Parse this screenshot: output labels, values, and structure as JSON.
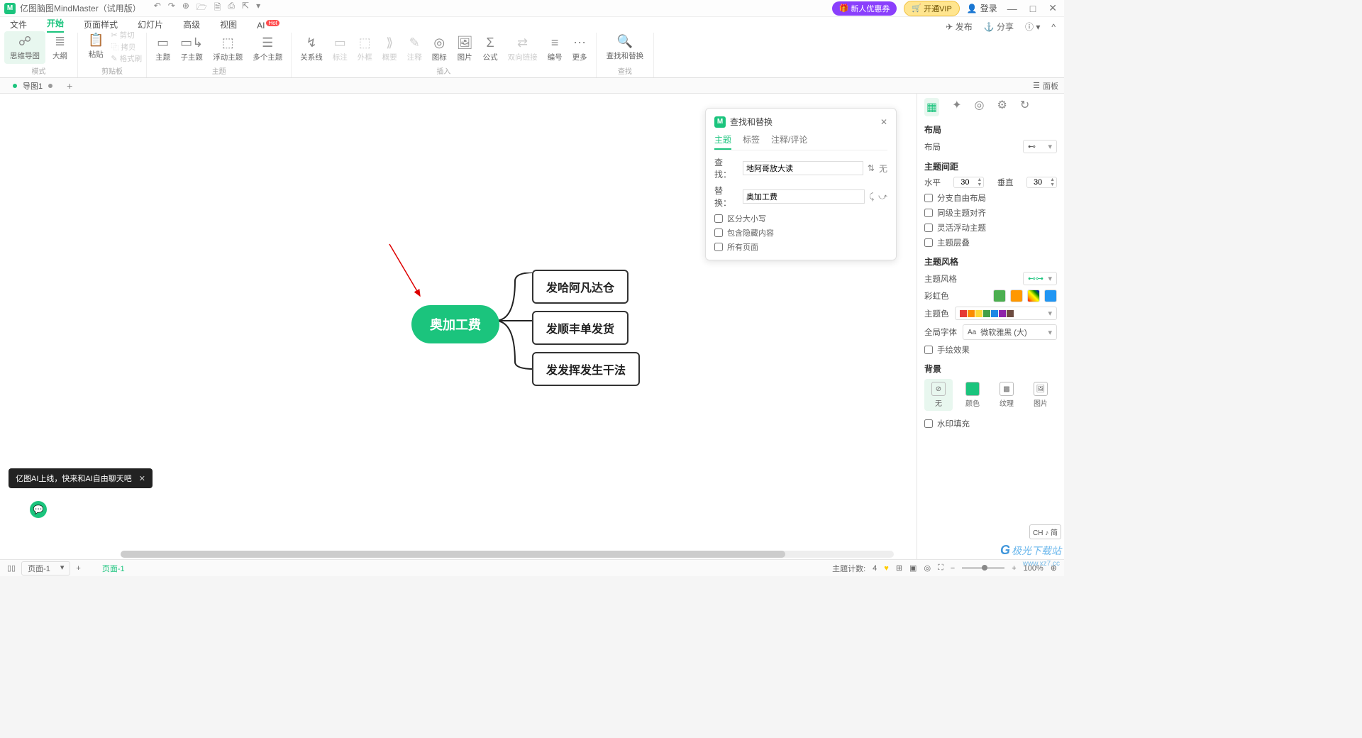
{
  "titlebar": {
    "app_logo": "M",
    "app_name": "亿图脑图MindMaster（试用版）",
    "promo1": "新人优惠券",
    "promo2": "开通VIP",
    "login": "登录",
    "min": "—",
    "max": "□",
    "close": "✕"
  },
  "qa": {
    "undo": "↶",
    "redo": "↷",
    "new": "⊕",
    "open": "🗁",
    "save": "🗎",
    "print": "⎙",
    "export": "⇱",
    "more": "▾"
  },
  "menu": {
    "file": "文件",
    "start": "开始",
    "page": "页面样式",
    "slide": "幻灯片",
    "advanced": "高级",
    "view": "视图",
    "ai": "AI",
    "hot": "Hot",
    "publish": "发布",
    "share": "分享",
    "help": "?",
    "collapse": "^"
  },
  "ribbon": {
    "mode": {
      "mindmap": "思维导图",
      "outline": "大纲",
      "group": "模式"
    },
    "clip": {
      "paste": "粘贴",
      "cut": "剪切",
      "copy": "拷贝",
      "format": "格式刷",
      "group": "剪贴板"
    },
    "topic": {
      "topic": "主题",
      "sub": "子主题",
      "float": "浮动主题",
      "multi": "多个主题",
      "group": "主题"
    },
    "insert": {
      "relation": "关系线",
      "mark": "标注",
      "boundary": "外框",
      "summary": "概要",
      "comment": "注释",
      "icon": "图标",
      "image": "图片",
      "formula": "公式",
      "link": "双向链接",
      "number": "编号",
      "more": "更多",
      "group": "插入"
    },
    "find": {
      "find": "查找和替换",
      "group": "查找"
    }
  },
  "doctab": {
    "name": "导图1",
    "panel": "面板"
  },
  "mindmap": {
    "central": "奥加工费",
    "child1": "发哈阿凡达仓",
    "child2": "发顺丰单发货",
    "child3": "发发挥发生干法"
  },
  "find": {
    "title": "查找和替换",
    "tabs": {
      "topic": "主题",
      "tag": "标签",
      "note": "注释/评论"
    },
    "find_label": "查找：",
    "find_value": "地阿哥放大读",
    "replace_label": "替换：",
    "replace_value": "奥加工费",
    "none": "无",
    "chk1": "区分大小写",
    "chk2": "包含隐藏内容",
    "chk3": "所有页面"
  },
  "panel": {
    "layout_h": "布局",
    "layout_label": "布局",
    "spacing_h": "主题间距",
    "horiz": "水平",
    "vert": "垂直",
    "h_val": "30",
    "v_val": "30",
    "chk_free": "分支自由布局",
    "chk_align": "同级主题对齐",
    "chk_float": "灵活浮动主题",
    "chk_stack": "主题层叠",
    "style_h": "主题风格",
    "style_label": "主题风格",
    "rainbow": "彩虹色",
    "theme_color": "主题色",
    "font": "全局字体",
    "font_val": "微软雅黑 (大)",
    "chk_hand": "手绘效果",
    "bg_h": "背景",
    "bg_none": "无",
    "bg_color": "颜色",
    "bg_texture": "纹理",
    "bg_image": "图片",
    "chk_wm": "水印填充",
    "ime": "CH ♪ 简"
  },
  "toast": {
    "text": "亿图AI上线，快来和AI自由聊天吧",
    "close": "✕"
  },
  "status": {
    "page_label": "页面-1",
    "page_tab": "页面-1",
    "plus": "+",
    "topic_count_label": "主题计数:",
    "topic_count": "4",
    "zoom": "100%",
    "minus": "−",
    "plusz": "+"
  },
  "watermark": "极光下载站",
  "watermark_url": "www.xz7.cc"
}
